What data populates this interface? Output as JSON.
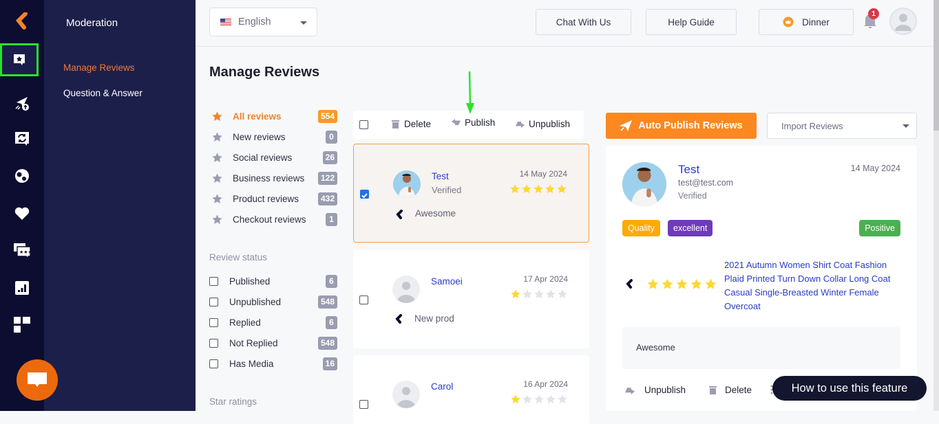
{
  "app": {
    "section_title": "Moderation",
    "rail_items": [
      {
        "name": "reviews-icon",
        "active": true
      },
      {
        "name": "rocket-upload-icon",
        "active": false
      },
      {
        "name": "sync-chat-icon",
        "active": false
      },
      {
        "name": "loyalty-icon",
        "active": false
      },
      {
        "name": "heart-icon",
        "active": false
      },
      {
        "name": "chat-stars-icon",
        "active": false
      },
      {
        "name": "analytics-icon",
        "active": false
      },
      {
        "name": "apps-grid-icon",
        "active": false
      }
    ],
    "subnav": [
      {
        "label": "Manage Reviews",
        "active": true
      },
      {
        "label": "Question & Answer",
        "active": false
      }
    ]
  },
  "topbar": {
    "language": "English",
    "chat_label": "Chat With Us",
    "help_label": "Help Guide",
    "plan_label": "Dinner",
    "notification_count": "1"
  },
  "page": {
    "title": "Manage Reviews"
  },
  "filters": {
    "categories": [
      {
        "label": "All reviews",
        "count": "554",
        "active": true
      },
      {
        "label": "New reviews",
        "count": "0",
        "active": false
      },
      {
        "label": "Social reviews",
        "count": "26",
        "active": false
      },
      {
        "label": "Business reviews",
        "count": "122",
        "active": false
      },
      {
        "label": "Product reviews",
        "count": "432",
        "active": false
      },
      {
        "label": "Checkout reviews",
        "count": "1",
        "active": false
      }
    ],
    "status_title": "Review status",
    "statuses": [
      {
        "label": "Published",
        "count": "6",
        "checked": false
      },
      {
        "label": "Unpublished",
        "count": "548",
        "checked": false
      },
      {
        "label": "Replied",
        "count": "6",
        "checked": false
      },
      {
        "label": "Not Replied",
        "count": "548",
        "checked": false
      },
      {
        "label": "Has Media",
        "count": "16",
        "checked": false
      }
    ],
    "star_title": "Star ratings"
  },
  "bulk": {
    "delete_label": "Delete",
    "publish_label": "Publish",
    "unpublish_label": "Unpublish"
  },
  "reviews": [
    {
      "name": "Test",
      "verified": "Verified",
      "date": "14 May 2024",
      "rating": 5,
      "text": "Awesome",
      "selected": true,
      "has_photo": true
    },
    {
      "name": "Samoei",
      "verified": "",
      "date": "17 Apr 2024",
      "rating": 1,
      "text": "New prod",
      "selected": false,
      "has_photo": false
    },
    {
      "name": "Carol",
      "verified": "",
      "date": "16 Apr 2024",
      "rating": 1,
      "text": "",
      "selected": false,
      "has_photo": false
    }
  ],
  "actions": {
    "auto_publish_label": "Auto Publish Reviews",
    "import_label": "Import Reviews"
  },
  "detail": {
    "name": "Test",
    "email": "test@test.com",
    "verified": "Verified",
    "date": "14 May 2024",
    "tags": [
      {
        "label": "Quality",
        "color": "#fbab05"
      },
      {
        "label": "excellent",
        "color": "#6f3bb8"
      }
    ],
    "sentiment": {
      "label": "Positive",
      "color": "#4caf50"
    },
    "rating": 5,
    "product": "2021 Autumn Women Shirt Coat Fashion Plaid Printed Turn Down Collar Long Coat Casual Single-Breasted Winter Female Overcoat",
    "body": "Awesome",
    "unpublish_label": "Unpublish",
    "delete_label": "Delete"
  },
  "help_pill": "How to use this feature",
  "colors": {
    "accent_orange": "#fb8820",
    "link_blue": "#2a3cc7",
    "star_yellow": "#fdd835",
    "rail_bg": "#0c0d30",
    "subnav_bg": "#1c1f4a",
    "highlight_green": "#29e32c"
  }
}
